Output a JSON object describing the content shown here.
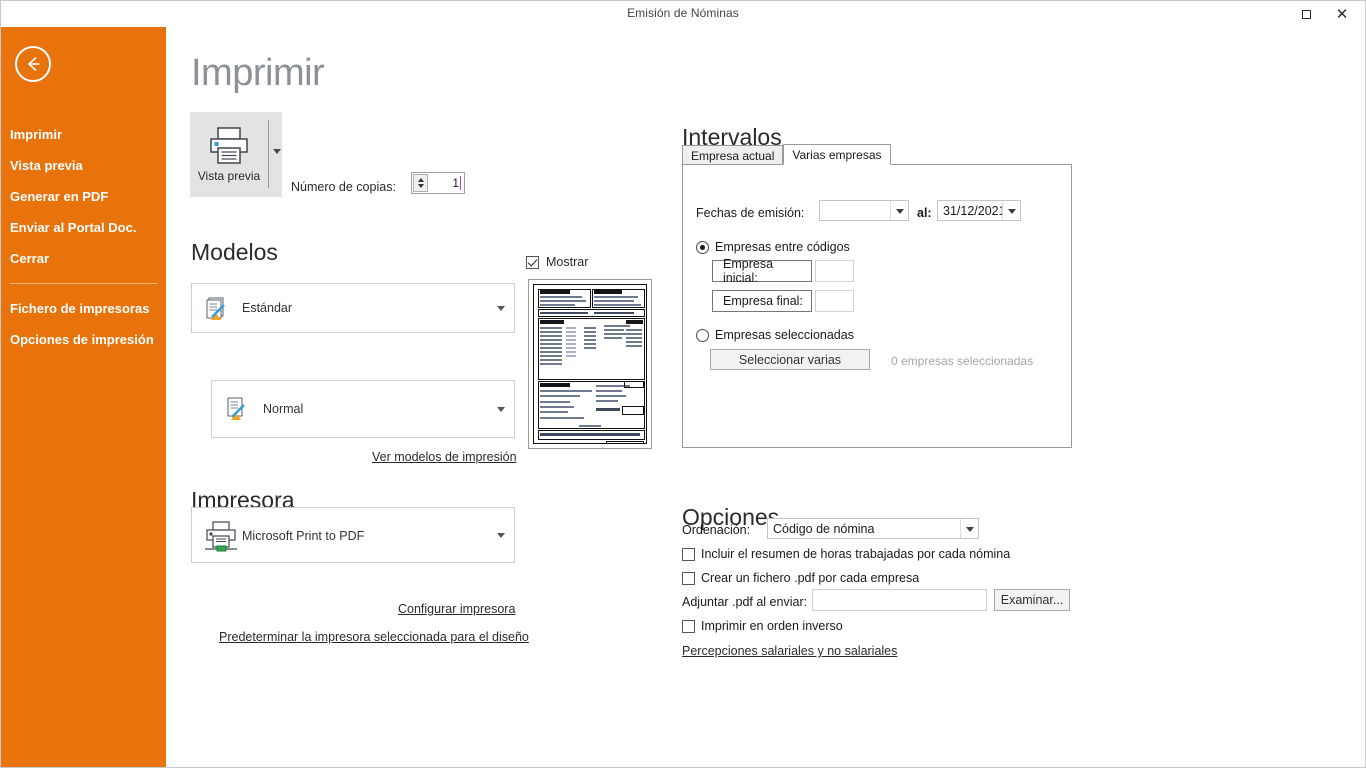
{
  "window": {
    "title": "Emisión de Nóminas",
    "restore_icon": "restore-icon",
    "close_icon": "close-icon"
  },
  "sidebar": {
    "back_icon": "back-arrow-icon",
    "accent_color": "#e8730c",
    "items": [
      {
        "label": "Imprimir"
      },
      {
        "label": "Vista previa"
      },
      {
        "label": "Generar en PDF"
      },
      {
        "label": "Enviar al Portal Doc."
      },
      {
        "label": "Cerrar"
      }
    ],
    "items_secondary": [
      {
        "label": "Fichero de impresoras"
      },
      {
        "label": "Opciones de impresión"
      }
    ]
  },
  "main": {
    "page_title": "Imprimir",
    "preview_button": {
      "label": "Vista previa",
      "icon": "printer-preview-icon",
      "dropdown_icon": "chevron-down-icon"
    },
    "copies": {
      "label": "Número de copias:",
      "value": "1"
    },
    "modelos": {
      "title": "Modelos",
      "model_primary": {
        "value": "Estándar",
        "icon": "documents-edit-icon"
      },
      "model_secondary": {
        "value": "Normal",
        "icon": "document-edit-icon"
      },
      "link": "Ver modelos de impresión"
    },
    "preview_thumb": {
      "show_label": "Mostrar",
      "show_checked": true
    },
    "impresora": {
      "title": "Impresora",
      "selected": "Microsoft Print to PDF",
      "icon": "printer-icon",
      "link_configure": "Configurar impresora",
      "link_default": "Predeterminar la impresora seleccionada para el diseño"
    }
  },
  "intervalos": {
    "title": "Intervalos",
    "tabs": [
      {
        "label": "Empresa actual",
        "active": false
      },
      {
        "label": "Varias empresas",
        "active": true
      }
    ],
    "fechas": {
      "label": "Fechas de emisión:",
      "from_value": "",
      "between_label": "al:",
      "to_value": "31/12/2021"
    },
    "radio_codigos": {
      "label": "Empresas entre códigos",
      "selected": true
    },
    "empresa_inicial": {
      "label": "Empresa inicial:",
      "value": ""
    },
    "empresa_final": {
      "label": "Empresa final:",
      "value": ""
    },
    "radio_seleccionadas": {
      "label": "Empresas seleccionadas",
      "selected": false
    },
    "select_button": "Seleccionar varias",
    "selected_count_text": "0 empresas seleccionadas"
  },
  "opciones": {
    "title": "Opciones",
    "ordenacion": {
      "label": "Ordenación:",
      "value": "Código de nómina"
    },
    "checkboxes": [
      {
        "label": "Incluir el resumen de horas trabajadas por cada nómina",
        "checked": false
      },
      {
        "label": "Crear un fichero .pdf por cada empresa",
        "checked": false
      }
    ],
    "adjuntar": {
      "label": "Adjuntar .pdf al enviar:",
      "value": "",
      "browse_button": "Examinar..."
    },
    "inverso": {
      "label": "Imprimir en orden inverso",
      "checked": false
    },
    "link": "Percepciones salariales y no salariales"
  }
}
